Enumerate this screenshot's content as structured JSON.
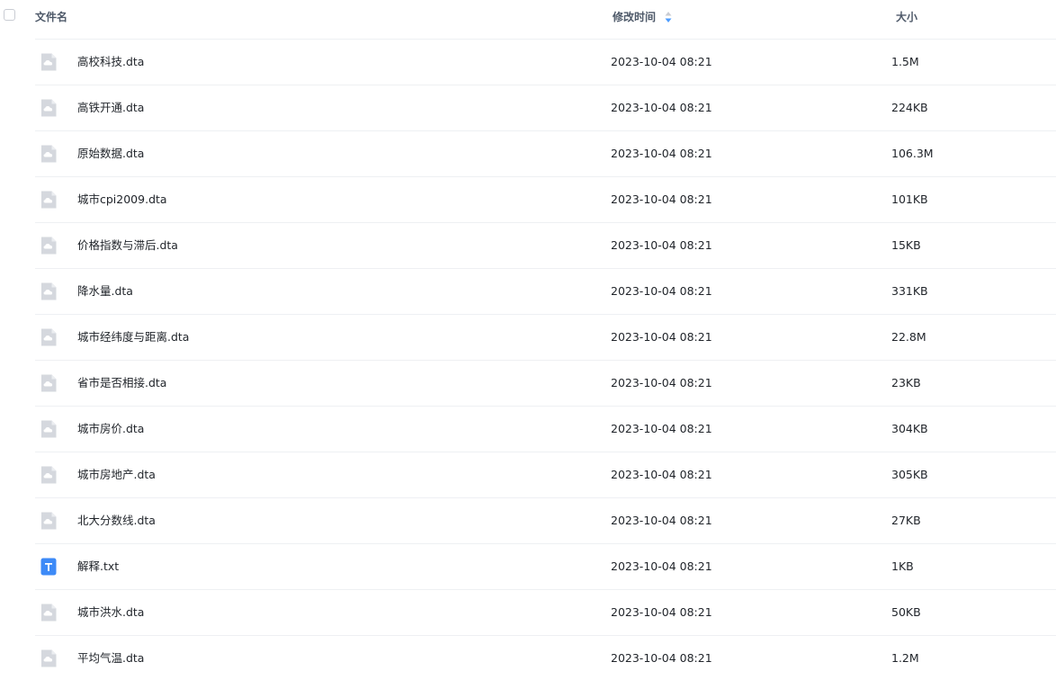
{
  "header": {
    "name_label": "文件名",
    "time_label": "修改时间",
    "size_label": "大小"
  },
  "colors": {
    "sort_active": "#4c9cff",
    "sort_inactive": "#c9ccd3",
    "file_icon_gray": "#d5d8de",
    "txt_icon_blue": "#3d8af7"
  },
  "files": [
    {
      "name": "高校科技.dta",
      "time": "2023-10-04 08:21",
      "size": "1.5M",
      "icon": "cloud-file-icon"
    },
    {
      "name": "高铁开通.dta",
      "time": "2023-10-04 08:21",
      "size": "224KB",
      "icon": "cloud-file-icon"
    },
    {
      "name": "原始数据.dta",
      "time": "2023-10-04 08:21",
      "size": "106.3M",
      "icon": "cloud-file-icon"
    },
    {
      "name": "城市cpi2009.dta",
      "time": "2023-10-04 08:21",
      "size": "101KB",
      "icon": "cloud-file-icon"
    },
    {
      "name": "价格指数与滞后.dta",
      "time": "2023-10-04 08:21",
      "size": "15KB",
      "icon": "cloud-file-icon"
    },
    {
      "name": "降水量.dta",
      "time": "2023-10-04 08:21",
      "size": "331KB",
      "icon": "cloud-file-icon"
    },
    {
      "name": "城市经纬度与距离.dta",
      "time": "2023-10-04 08:21",
      "size": "22.8M",
      "icon": "cloud-file-icon"
    },
    {
      "name": "省市是否相接.dta",
      "time": "2023-10-04 08:21",
      "size": "23KB",
      "icon": "cloud-file-icon"
    },
    {
      "name": "城市房价.dta",
      "time": "2023-10-04 08:21",
      "size": "304KB",
      "icon": "cloud-file-icon"
    },
    {
      "name": "城市房地产.dta",
      "time": "2023-10-04 08:21",
      "size": "305KB",
      "icon": "cloud-file-icon"
    },
    {
      "name": "北大分数线.dta",
      "time": "2023-10-04 08:21",
      "size": "27KB",
      "icon": "cloud-file-icon"
    },
    {
      "name": "解释.txt",
      "time": "2023-10-04 08:21",
      "size": "1KB",
      "icon": "text-file-icon"
    },
    {
      "name": "城市洪水.dta",
      "time": "2023-10-04 08:21",
      "size": "50KB",
      "icon": "cloud-file-icon"
    },
    {
      "name": "平均气温.dta",
      "time": "2023-10-04 08:21",
      "size": "1.2M",
      "icon": "cloud-file-icon"
    }
  ]
}
